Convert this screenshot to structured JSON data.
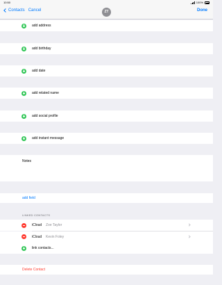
{
  "status_bar": {
    "time": "10:50",
    "battery": "100%"
  },
  "nav": {
    "back_label": "Contacts",
    "cancel_label": "Cancel",
    "avatar_initials": "ZT",
    "done_label": "Done"
  },
  "add_rows": [
    {
      "label": "add address"
    },
    {
      "label": "add birthday"
    },
    {
      "label": "add date"
    },
    {
      "label": "add related name"
    },
    {
      "label": "add social profile"
    },
    {
      "label": "add instant message"
    }
  ],
  "notes": {
    "label": "Notes"
  },
  "add_field": {
    "label": "add field"
  },
  "linked_contacts": {
    "header": "LINKED CONTACTS",
    "items": [
      {
        "service": "iCloud",
        "name": "Zoe Taylor"
      },
      {
        "service": "iCloud",
        "name": "Kevin Foley"
      }
    ],
    "link_label": "link contacts..."
  },
  "delete": {
    "label": "Delete Contact"
  },
  "colors": {
    "accent": "#007aff",
    "add": "#34c759",
    "remove": "#ff3b30",
    "background": "#efeff4"
  }
}
